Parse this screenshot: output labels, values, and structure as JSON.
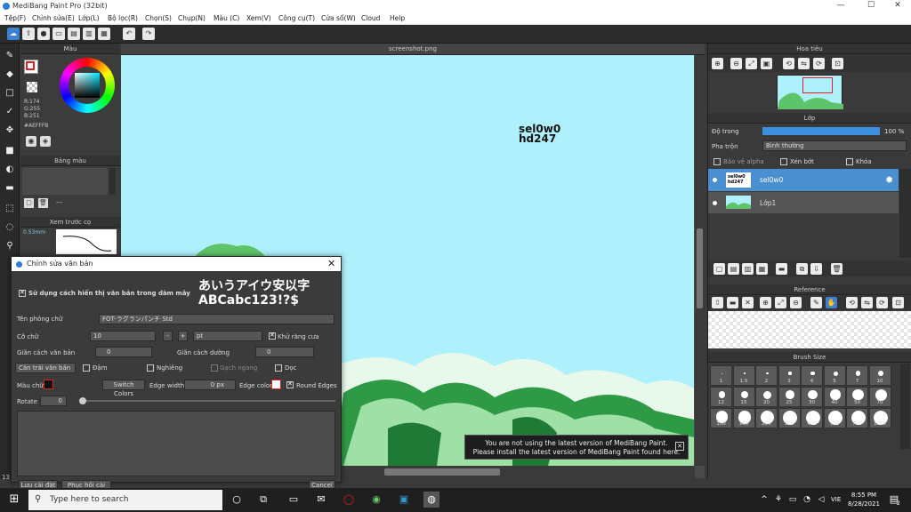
{
  "window": {
    "title": "MediBang Paint Pro (32bit)",
    "min": "—",
    "max": "☐",
    "close": "✕"
  },
  "menu": [
    "Tệp(F)",
    "Chỉnh sửa(E)",
    "Lớp(L)",
    "Bộ lọc(R)",
    "Chọn(S)",
    "Chụp(N)",
    "Màu (C)",
    "Xem(V)",
    "Công cụ(T)",
    "Cửa sổ(W)",
    "Cloud",
    "Help"
  ],
  "color_panel": {
    "title": "Màu",
    "r": "R:174",
    "g": "G:255",
    "b": "B:251",
    "hex": "#AEFFFB",
    "fg": "#e02020",
    "bg": "#ffffff"
  },
  "palette_panel": {
    "title": "Bảng màu",
    "dash": "---"
  },
  "preview_panel": {
    "title": "Xem trước cọ",
    "size": "0.53mm"
  },
  "document": {
    "tab": "screenshot.png",
    "canvas_color": "#aef0fb"
  },
  "canvas_text": {
    "line1": "sel0w0",
    "line2": "hd247"
  },
  "navigator": {
    "title": "Hoa tiêu"
  },
  "layer_panel": {
    "title": "Lớp",
    "opacity_label": "Độ trong",
    "opacity_value": "100 %",
    "blend_label": "Pha trộn",
    "blend_value": "Bình thường",
    "protect_alpha": "Bảo vệ alpha",
    "clipping": "Xén bớt",
    "lock": "Khóa",
    "layers": [
      {
        "name": "sel0w0",
        "selected": true
      },
      {
        "name": "Lớp1",
        "selected": false
      }
    ]
  },
  "reference_panel": {
    "title": "Reference"
  },
  "brush_size_panel": {
    "title": "Brush Size",
    "sizes": [
      "1",
      "1.5",
      "2",
      "3",
      "4",
      "5",
      "7",
      "10",
      "12",
      "15",
      "20",
      "25",
      "30",
      "40",
      "50",
      "70",
      "100",
      "150",
      "200",
      "300",
      "400",
      "500",
      "700",
      "1000"
    ]
  },
  "text_dialog": {
    "title": "Chỉnh sửa văn bản",
    "use_canvas_display": "Sử dụng cách hiển thị văn bản trong dàm mây",
    "preview_line1": "あいうアイウ安以字",
    "preview_line2": "ABCabc123!?$",
    "font_label": "Tên phông chữ",
    "font_value": "FOT-ラグランパンチ Std",
    "size_label": "Cỡ chữ",
    "size_value": "10",
    "size_unit": "pt",
    "antialias": "Khử răng cưa",
    "char_spacing_label": "Giãn cách văn bản",
    "char_spacing_value": "0",
    "line_spacing_label": "Giãn cách dường",
    "line_spacing_value": "0",
    "align_value": "Căn trái văn bản",
    "bold": "Đậm",
    "italic": "Nghiêng",
    "underline": "Gạch ngang",
    "vertical": "Dọc",
    "text_color_label": "Màu chữ",
    "switch_colors": "Switch Colors",
    "edge_width_label": "Edge width",
    "edge_width_value": "0 px",
    "edge_color_label": "Edge color",
    "round_edges": "Round Edges",
    "rotate_label": "Rotate",
    "rotate_value": "0",
    "btn_left1": "Lưu cài đặt",
    "btn_left2": "Phục hồi cài đặt",
    "btn_cancel": "Cancel"
  },
  "toast": {
    "line1": "You are not using the latest version of MediBang Paint.",
    "line2": "Please install the latest version of MediBang Paint found here."
  },
  "status": {
    "zoom": "13"
  },
  "taskbar": {
    "search_placeholder": "Type here to search",
    "time": "8:55 PM",
    "date": "8/28/2021",
    "lang": "VIE",
    "notif_count": "2"
  }
}
